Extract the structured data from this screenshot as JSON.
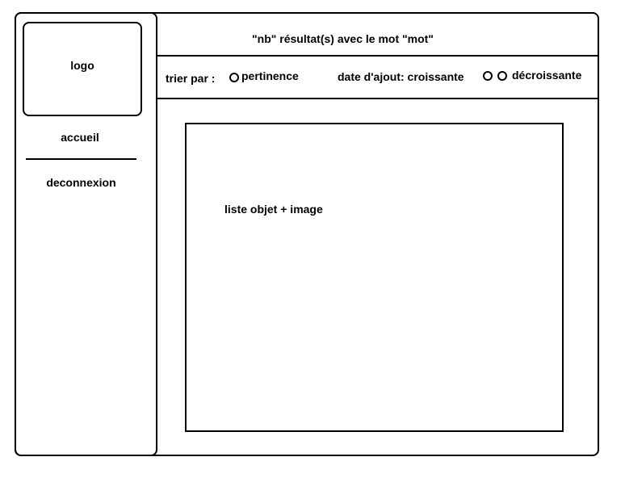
{
  "sidebar": {
    "logo_label": "logo",
    "nav": {
      "accueil": "accueil",
      "deconnexion": "deconnexion"
    }
  },
  "header": {
    "results_text": "\"nb\" résultat(s) avec le mot \"mot\""
  },
  "sort_bar": {
    "label": "trier par :",
    "options": {
      "pertinence": "pertinence",
      "date_prefix": "date d'ajout: croissante",
      "decroissante": "décroissante"
    }
  },
  "content": {
    "placeholder": "liste objet + image"
  }
}
